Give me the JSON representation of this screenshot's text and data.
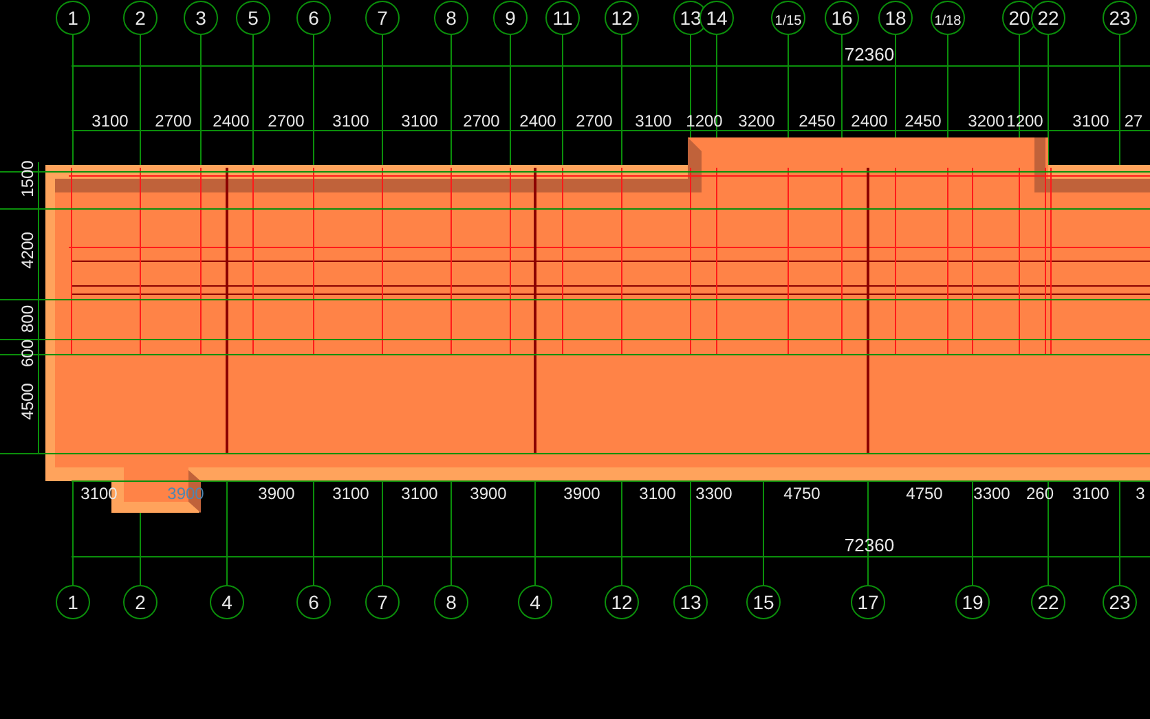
{
  "top_axes": [
    "1",
    "2",
    "3",
    "5",
    "6",
    "7",
    "8",
    "9",
    "11",
    "12",
    "13",
    "14",
    "1/15",
    "16",
    "18",
    "1/18",
    "20",
    "22",
    "23"
  ],
  "top_total": "72360",
  "top_dimensions": [
    "3100",
    "2700",
    "2400",
    "2700",
    "3100",
    "3100",
    "2700",
    "2400",
    "2700",
    "3100",
    "1200",
    "3200",
    "2450",
    "2400",
    "2450",
    "3200",
    "1200",
    "3100",
    "27"
  ],
  "left_dimensions": [
    "1500",
    "4200",
    "800",
    "600",
    "4500"
  ],
  "bottom_dimensions": [
    {
      "text": "3100",
      "highlighted": false
    },
    {
      "text": "3900",
      "highlighted": true
    },
    {
      "text": "3900",
      "highlighted": false
    },
    {
      "text": "3100",
      "highlighted": false
    },
    {
      "text": "3100",
      "highlighted": false
    },
    {
      "text": "3900",
      "highlighted": false
    },
    {
      "text": "3900",
      "highlighted": false
    },
    {
      "text": "3100",
      "highlighted": false
    },
    {
      "text": "3300",
      "highlighted": false
    },
    {
      "text": "4750",
      "highlighted": false
    },
    {
      "text": "4750",
      "highlighted": false
    },
    {
      "text": "3300",
      "highlighted": false
    },
    {
      "text": "260",
      "highlighted": false
    },
    {
      "text": "3100",
      "highlighted": false
    },
    {
      "text": "3",
      "highlighted": false
    }
  ],
  "bottom_total": "72360",
  "bottom_axes": [
    "1",
    "2",
    "4",
    "6",
    "7",
    "8",
    "4",
    "12",
    "13",
    "15",
    "17",
    "19",
    "22",
    "23"
  ]
}
